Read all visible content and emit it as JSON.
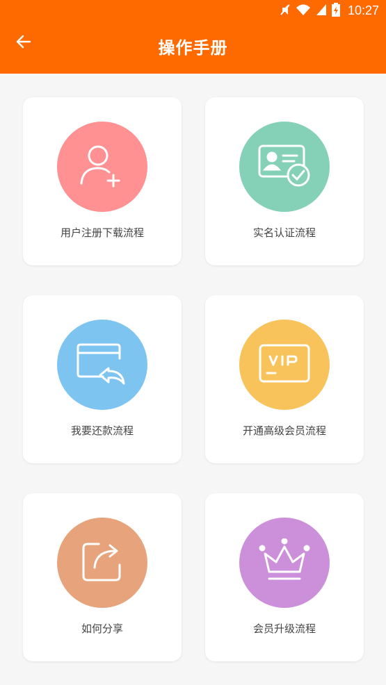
{
  "status_bar": {
    "time": "10:27",
    "icons": [
      "mute-icon",
      "wifi-icon",
      "signal-icon",
      "battery-charging-icon"
    ]
  },
  "app_bar": {
    "title": "操作手册",
    "back_icon": "arrow-left-icon"
  },
  "colors": {
    "header": "#ff6a00",
    "background": "#f6f6f6",
    "card": "#ffffff"
  },
  "cards": [
    {
      "label": "用户注册下载流程",
      "icon": "user-add-icon",
      "color": "#ff9193"
    },
    {
      "label": "实名认证流程",
      "icon": "id-card-check-icon",
      "color": "#84d1b8"
    },
    {
      "label": "我要还款流程",
      "icon": "card-return-icon",
      "color": "#7ec4f0"
    },
    {
      "label": "开通高级会员流程",
      "icon": "vip-card-icon",
      "color": "#f7c35a"
    },
    {
      "label": "如何分享",
      "icon": "share-icon",
      "color": "#e7a47c"
    },
    {
      "label": "会员升级流程",
      "icon": "crown-icon",
      "color": "#cc8fd9"
    }
  ]
}
